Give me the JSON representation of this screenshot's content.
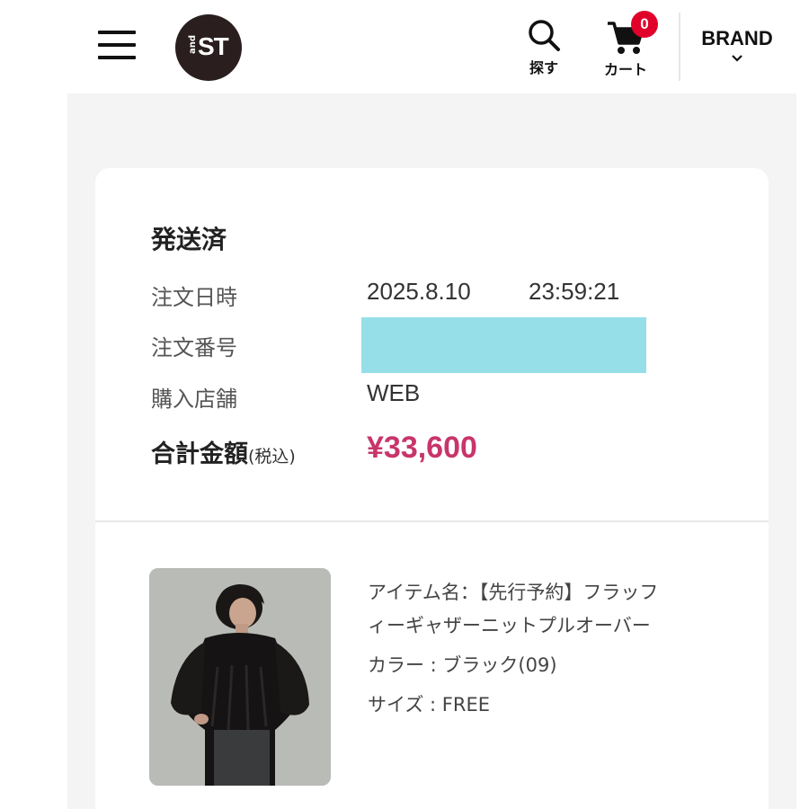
{
  "header": {
    "logo": {
      "prefix": "and",
      "mark": "ST"
    },
    "search_label": "探す",
    "cart_label": "カート",
    "cart_count": "0",
    "brand_label": "BRAND",
    "colors": {
      "badge": "#e0002a",
      "logo_bg": "#2a1e1e"
    },
    "icons": [
      "menu-icon",
      "search-icon",
      "cart-icon",
      "chevron-down-icon"
    ]
  },
  "order": {
    "status": "発送済",
    "date_label": "注文日時",
    "date": "2025.8.10",
    "time": "23:59:21",
    "number_label": "注文番号",
    "number_redacted": true,
    "store_label": "購入店舗",
    "store": "WEB",
    "total_label": "合計金額",
    "total_tax_note": "(税込)",
    "total": "¥33,600",
    "colors": {
      "total": "#c8356a",
      "redaction": "#96dfe8"
    }
  },
  "item": {
    "name_line1": "アイテム名：【先行予約】フラッフ",
    "name_line2": "ィーギャザーニットプルオーバー",
    "color": "カラー : ブラック(09)",
    "size": "サイズ : FREE"
  }
}
